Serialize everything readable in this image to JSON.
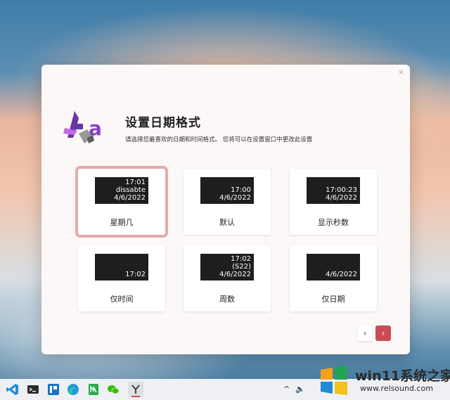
{
  "dialog": {
    "close_label": "×",
    "title": "设置日期格式",
    "subtitle": "请选择您最喜欢的日期和时间格式。 您将可以在设置窗口中更改此设置",
    "logo_letters": "Aa"
  },
  "cards": [
    {
      "lines": [
        "17:01",
        "dissabte",
        "4/6/2022"
      ],
      "label": "星期几",
      "selected": true
    },
    {
      "lines": [
        "17:00",
        "4/6/2022"
      ],
      "label": "默认",
      "selected": false
    },
    {
      "lines": [
        "17:00:23",
        "4/6/2022"
      ],
      "label": "显示秒数",
      "selected": false
    },
    {
      "lines": [
        "17:02"
      ],
      "label": "仅时间",
      "selected": false
    },
    {
      "lines": [
        "17:02",
        "(S22) 4/6/2022"
      ],
      "label": "周数",
      "selected": false
    },
    {
      "lines": [
        "4/6/2022"
      ],
      "label": "仅日期",
      "selected": false
    }
  ],
  "nav": {
    "prev": "‹",
    "next": "›"
  },
  "taskbar": {
    "icons": [
      "vscode-icon",
      "terminal-icon",
      "kanban-icon",
      "edge-icon",
      "notepad-icon",
      "wechat-icon",
      "app-y-icon"
    ],
    "tray": {
      "chevron": "^",
      "volume": "🔈"
    }
  },
  "watermark": {
    "title": "win11系统之家",
    "url": "www.relsound.com"
  },
  "colors": {
    "accent": "#c84d55",
    "selected_ring": "#e8a9a9",
    "preview_bg": "#1e1e1e"
  }
}
